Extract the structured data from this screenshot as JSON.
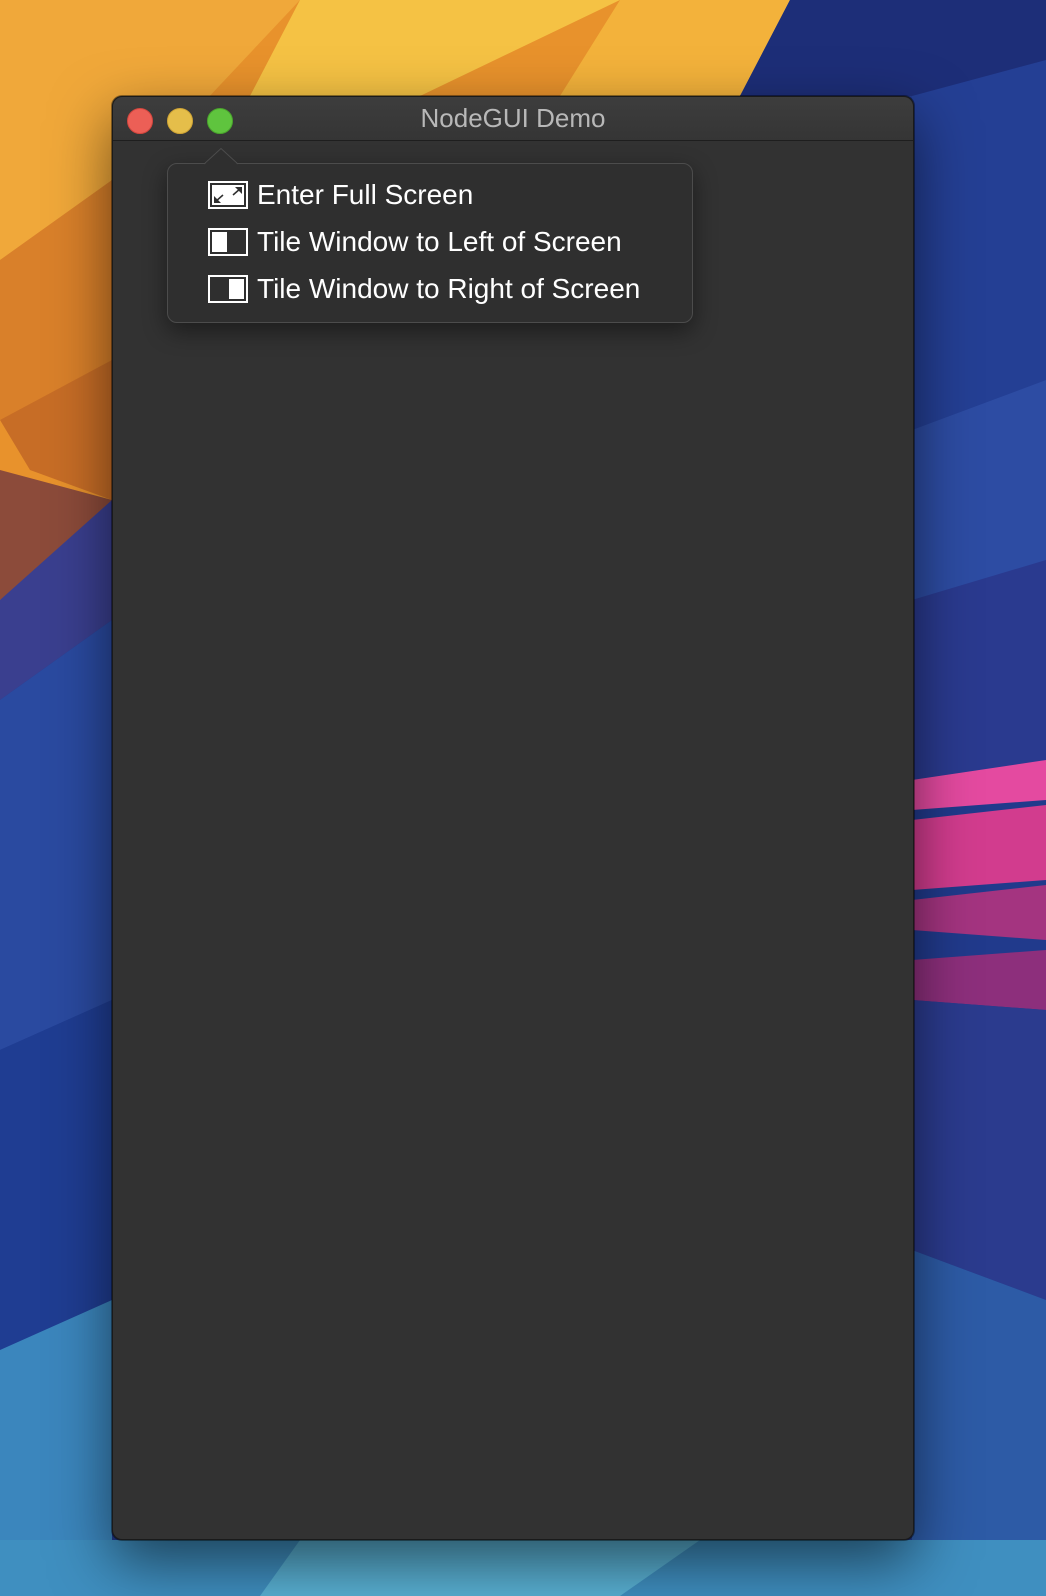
{
  "window": {
    "title": "NodeGUI Demo"
  },
  "titlebar": {
    "buttons": [
      {
        "name": "close",
        "color": "#ec5f56"
      },
      {
        "name": "minimize",
        "color": "#e5be4a"
      },
      {
        "name": "zoom",
        "color": "#5fc43e"
      }
    ]
  },
  "popover_menu": {
    "items": [
      {
        "label": "Enter Full Screen",
        "icon": "fullscreen-icon"
      },
      {
        "label": "Tile Window to Left of Screen",
        "icon": "tile-left-icon"
      },
      {
        "label": "Tile Window to Right of Screen",
        "icon": "tile-right-icon"
      }
    ]
  },
  "colors": {
    "window_background": "#323232",
    "titlebar_background": "#3a3a3a",
    "menu_text": "#ffffff",
    "title_text": "#b8b8b8"
  }
}
